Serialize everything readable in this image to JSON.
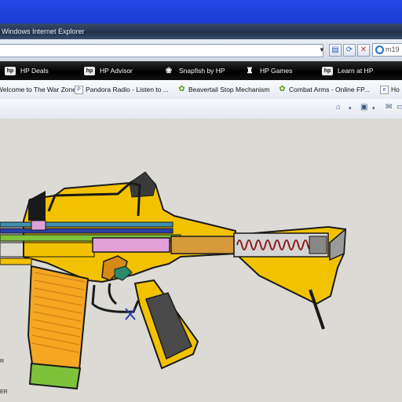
{
  "window": {
    "title": "Windows Internet Explorer"
  },
  "search": {
    "text": "m19"
  },
  "hp_toolbar": {
    "items": [
      {
        "label": "HP Deals",
        "icon": "hp-logo-icon"
      },
      {
        "label": "HP Advisor",
        "icon": "hp-logo-icon"
      },
      {
        "label": "Snapfish by HP",
        "icon": "snapfish-icon"
      },
      {
        "label": "HP Games",
        "icon": "games-icon"
      },
      {
        "label": "Learn at HP",
        "icon": "hp-logo-icon"
      }
    ]
  },
  "favorites": {
    "items": [
      {
        "label": "Welcome to The War Zone"
      },
      {
        "label": "Pandora Radio - Listen to ..."
      },
      {
        "label": "Beavertail Stop Mechanism"
      },
      {
        "label": "Combat Arms - Online FP..."
      },
      {
        "label": "Ho"
      }
    ]
  },
  "page": {
    "side_label_1": "R",
    "side_label_2": "ER"
  },
  "colors": {
    "gun_body": "#f2c200",
    "gun_outline": "#1a1a1a",
    "magazine": "#f5a623",
    "spring": "#8b1a1a",
    "bolt_carrier": "#e2a0d8",
    "background": "#dcdad5"
  }
}
